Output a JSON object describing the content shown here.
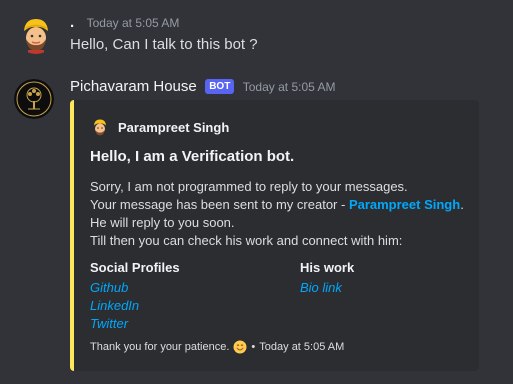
{
  "message_user": {
    "username": ".",
    "timestamp": "Today at 5:05 AM",
    "text": "Hello, Can I talk to this bot ?",
    "avatar_icon": "sikh-man-avatar-icon"
  },
  "message_bot": {
    "username": "Pichavaram House",
    "badge": "BOT",
    "timestamp": "Today at 5:05 AM",
    "avatar_icon": "tree-logo-avatar-icon"
  },
  "embed": {
    "accent_color": "#fee75c",
    "author": "Parampreet Singh",
    "title": "Hello, I am a Verification bot.",
    "desc_line1": "Sorry, I am not programmed to reply to your messages.",
    "desc_line2_prefix": "Your message has been sent to my creator - ",
    "desc_mention": "Parampreet Singh",
    "desc_line2_suffix": ".",
    "desc_line3": "He will reply to you soon.",
    "desc_line4": "Till then you can check his work and connect with him:",
    "field1_name": "Social Profiles",
    "field1_links": [
      "Github",
      "LinkedIn",
      "Twitter"
    ],
    "field2_name": "His work",
    "field2_links": [
      "Bio link"
    ],
    "footer_text": "Thank you for your patience.",
    "footer_separator": "•",
    "footer_timestamp": "Today at 5:05 AM"
  },
  "colors": {
    "background": "#313338",
    "embed_background": "#2b2d31",
    "link": "#00a8fc",
    "bot_badge": "#5865f2"
  }
}
